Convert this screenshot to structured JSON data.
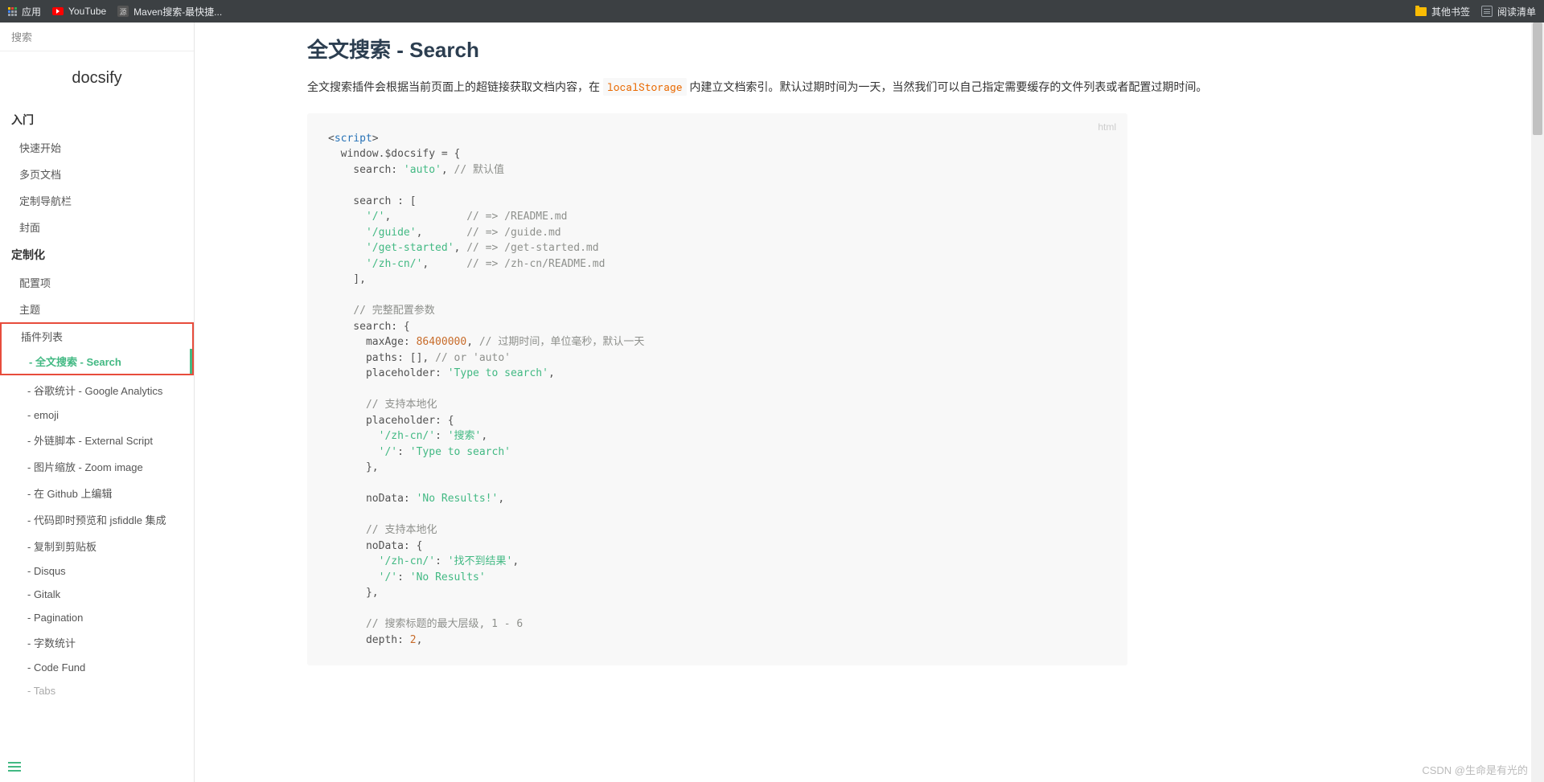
{
  "browser": {
    "apps": "应用",
    "youtube": "YouTube",
    "maven": "Maven搜索-最快捷...",
    "other_bookmarks": "其他书签",
    "reading_list": "阅读清单"
  },
  "sidebar": {
    "search_placeholder": "搜索",
    "app_name": "docsify",
    "sections": [
      {
        "header": "入门",
        "items": [
          "快速开始",
          "多页文档",
          "定制导航栏",
          "封面"
        ]
      },
      {
        "header": "定制化",
        "items": [
          "配置项",
          "主题"
        ]
      }
    ],
    "highlighted_section_header": "插件列表",
    "highlighted_active": "- 全文搜索 - Search",
    "plugin_items": [
      "- 谷歌统计 - Google Analytics",
      "- emoji",
      "- 外链脚本 - External Script",
      "- 图片缩放 - Zoom image",
      "- 在 Github 上编辑",
      "- 代码即时预览和 jsfiddle 集成",
      "- 复制到剪贴板",
      "- Disqus",
      "- Gitalk",
      "- Pagination",
      "- 字数统计",
      "- Code Fund",
      "- Tabs"
    ]
  },
  "content": {
    "title": "全文搜索 - Search",
    "desc_before": "全文搜索插件会根据当前页面上的超链接获取文档内容，在 ",
    "desc_code": "localStorage",
    "desc_after": " 内建立文档索引。默认过期时间为一天，当然我们可以自己指定需要缓存的文件列表或者配置过期时间。",
    "code_lang": "html",
    "code": {
      "l1": "script",
      "l2": "  window.$docsify = {",
      "l3a": "    search: ",
      "l3b": "'auto'",
      "l3c": ", ",
      "l3d": "// 默认值",
      "l5": "    search : [",
      "l6a": "      ",
      "l6b": "'/'",
      "l6c": ",            ",
      "l6d": "// => /README.md",
      "l7a": "      ",
      "l7b": "'/guide'",
      "l7c": ",       ",
      "l7d": "// => /guide.md",
      "l8a": "      ",
      "l8b": "'/get-started'",
      "l8c": ", ",
      "l8d": "// => /get-started.md",
      "l9a": "      ",
      "l9b": "'/zh-cn/'",
      "l9c": ",      ",
      "l9d": "// => /zh-cn/README.md",
      "l10": "    ],",
      "l12a": "    ",
      "l12b": "// 完整配置参数",
      "l13": "    search: {",
      "l14a": "      maxAge: ",
      "l14b": "86400000",
      "l14c": ", ",
      "l14d": "// 过期时间，单位毫秒，默认一天",
      "l15a": "      paths: [], ",
      "l15b": "// or 'auto'",
      "l16a": "      placeholder: ",
      "l16b": "'Type to search'",
      "l16c": ",",
      "l18a": "      ",
      "l18b": "// 支持本地化",
      "l19": "      placeholder: {",
      "l20a": "        ",
      "l20b": "'/zh-cn/'",
      "l20c": ": ",
      "l20d": "'搜索'",
      "l20e": ",",
      "l21a": "        ",
      "l21b": "'/'",
      "l21c": ": ",
      "l21d": "'Type to search'",
      "l22": "      },",
      "l24a": "      noData: ",
      "l24b": "'No Results!'",
      "l24c": ",",
      "l26a": "      ",
      "l26b": "// 支持本地化",
      "l27": "      noData: {",
      "l28a": "        ",
      "l28b": "'/zh-cn/'",
      "l28c": ": ",
      "l28d": "'找不到结果'",
      "l28e": ",",
      "l29a": "        ",
      "l29b": "'/'",
      "l29c": ": ",
      "l29d": "'No Results'",
      "l30": "      },",
      "l32a": "      ",
      "l32b": "// 搜索标题的最大层级, 1 - 6",
      "l33a": "      depth: ",
      "l33b": "2",
      "l33c": ","
    }
  },
  "watermark": "CSDN @生命是有光的"
}
